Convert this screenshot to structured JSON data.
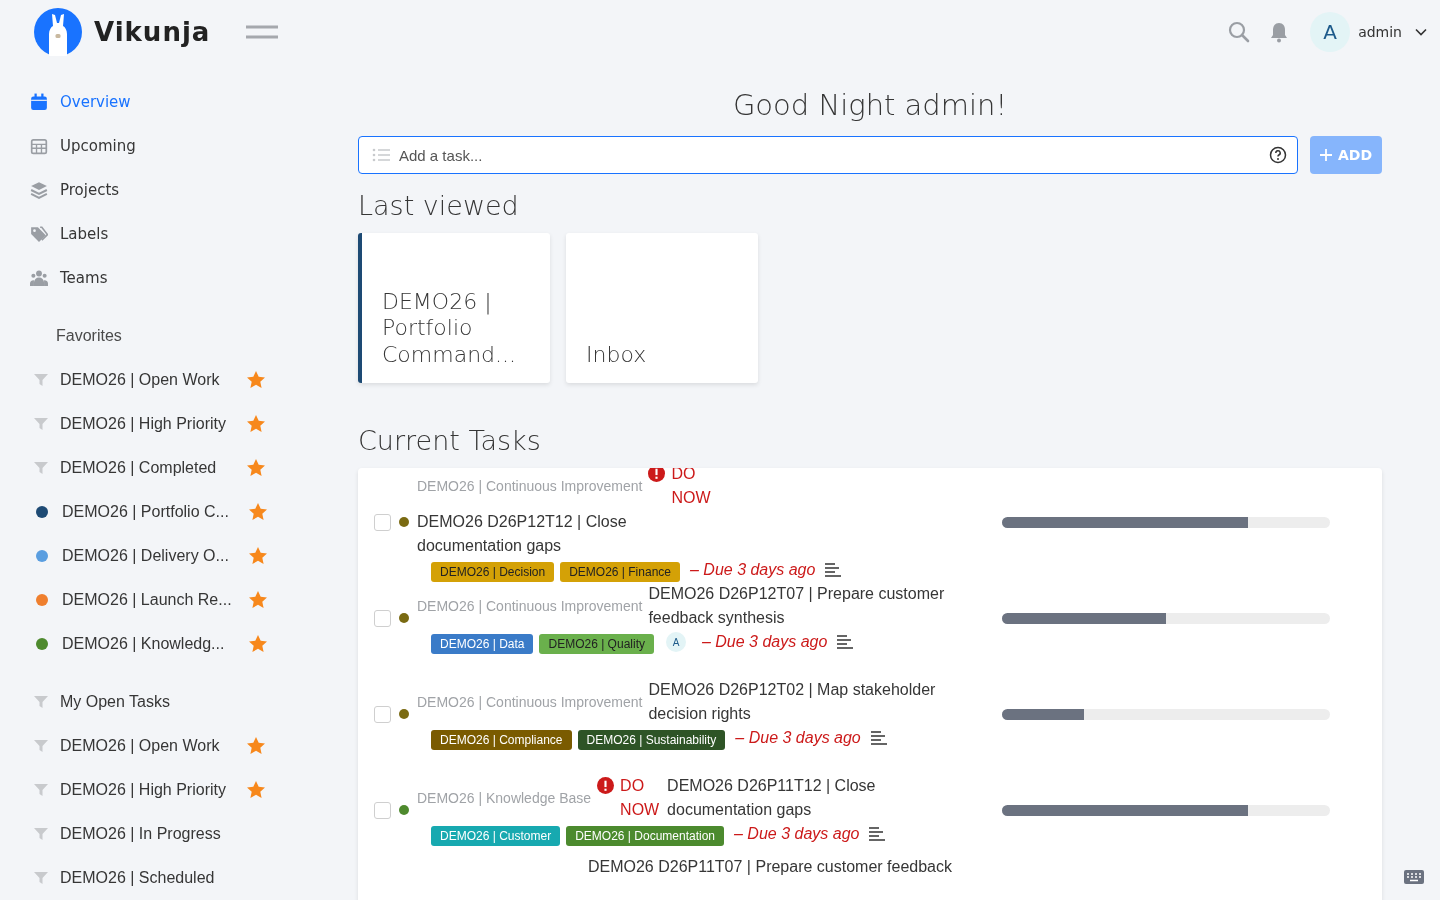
{
  "header": {
    "app_name": "Vikunja",
    "user": {
      "initial": "A",
      "name": "admin"
    }
  },
  "nav": [
    {
      "kind": "calendar",
      "label": "Overview",
      "selected": true
    },
    {
      "kind": "grid",
      "label": "Upcoming",
      "selected": false
    },
    {
      "kind": "layers",
      "label": "Projects",
      "selected": false
    },
    {
      "kind": "tags",
      "label": "Labels",
      "selected": false
    },
    {
      "kind": "people",
      "label": "Teams",
      "selected": false
    }
  ],
  "sidebar_sections": [
    {
      "title": "Favorites",
      "items": [
        {
          "kind": "filter",
          "label": "DEMO26 | Open Work",
          "favorite": true
        },
        {
          "kind": "filter",
          "label": "DEMO26 | High Priority",
          "favorite": true
        },
        {
          "kind": "filter",
          "label": "DEMO26 | Completed",
          "favorite": true
        },
        {
          "kind": "project",
          "color": "#1d4a74",
          "label": "DEMO26 | Portfolio C...",
          "favorite": true
        },
        {
          "kind": "project",
          "color": "#5a9ee0",
          "label": "DEMO26 | Delivery O...",
          "favorite": true
        },
        {
          "kind": "project",
          "color": "#ef7f2e",
          "label": "DEMO26 | Launch Re...",
          "favorite": true
        },
        {
          "kind": "project",
          "color": "#4e8a2e",
          "label": "DEMO26 | Knowledg...",
          "favorite": true
        }
      ]
    },
    {
      "items": [
        {
          "kind": "filter",
          "label": "My Open Tasks",
          "favorite": false
        },
        {
          "kind": "filter",
          "label": "DEMO26 | Open Work",
          "favorite": true
        },
        {
          "kind": "filter",
          "label": "DEMO26 | High Priority",
          "favorite": true
        },
        {
          "kind": "filter",
          "label": "DEMO26 | In Progress",
          "favorite": false
        },
        {
          "kind": "filter",
          "label": "DEMO26 | Scheduled",
          "favorite": false
        }
      ]
    }
  ],
  "greeting": "Good Night admin!",
  "add_task": {
    "placeholder": "Add a task...",
    "button": "ADD"
  },
  "last_viewed": {
    "title": "Last viewed",
    "cards": [
      {
        "title": "DEMO26 | Portfolio Command...",
        "color": "#1d4a74"
      },
      {
        "title": "Inbox"
      }
    ]
  },
  "current_tasks": {
    "title": "Current Tasks",
    "tasks": [
      {
        "done": false,
        "project": "DEMO26 | Continuous Improvement",
        "color": "#7a6a12",
        "priority": "DO NOW",
        "title": "DEMO26 D26P12T12 | Close documentation gaps",
        "labels": [
          {
            "text": "DEMO26 | Decision",
            "color": "#d4a106"
          },
          {
            "text": "DEMO26 | Finance",
            "color": "#d4a106"
          }
        ],
        "due": "– Due 3 days ago",
        "has_description": true,
        "level": 0.75
      },
      {
        "done": false,
        "project": "DEMO26 | Continuous Improvement",
        "color": "#7a6a12",
        "title": "DEMO26 D26P12T07 | Prepare customer feedback synthesis",
        "labels": [
          {
            "text": "DEMO26 | Data",
            "color": "#3a7bc8"
          },
          {
            "text": "DEMO26 | Quality",
            "color": "#6ab04c"
          }
        ],
        "assignee": "A",
        "due": "– Due 3 days ago",
        "has_description": true,
        "level": 0.5
      },
      {
        "done": false,
        "project": "DEMO26 | Continuous Improvement",
        "color": "#7a6a12",
        "title": "DEMO26 D26P12T02 | Map stakeholder decision rights",
        "labels": [
          {
            "text": "DEMO26 | Compliance",
            "color": "#7a5b00"
          },
          {
            "text": "DEMO26 | Sustainability",
            "color": "#2e5426"
          }
        ],
        "due": "– Due 3 days ago",
        "has_description": true,
        "level": 0.25
      },
      {
        "done": false,
        "project": "DEMO26 | Knowledge Base",
        "color": "#4e8a2e",
        "priority": "DO NOW",
        "title": "DEMO26 D26P11T12 | Close documentation gaps",
        "labels": [
          {
            "text": "DEMO26 | Customer",
            "color": "#17a9b0"
          },
          {
            "text": "DEMO26 | Documentation",
            "color": "#4c8a2e"
          }
        ],
        "due": "– Due 3 days ago",
        "has_description": true,
        "level": 0.75
      },
      {
        "title": "DEMO26 D26P11T07 | Prepare customer feedback"
      }
    ]
  }
}
